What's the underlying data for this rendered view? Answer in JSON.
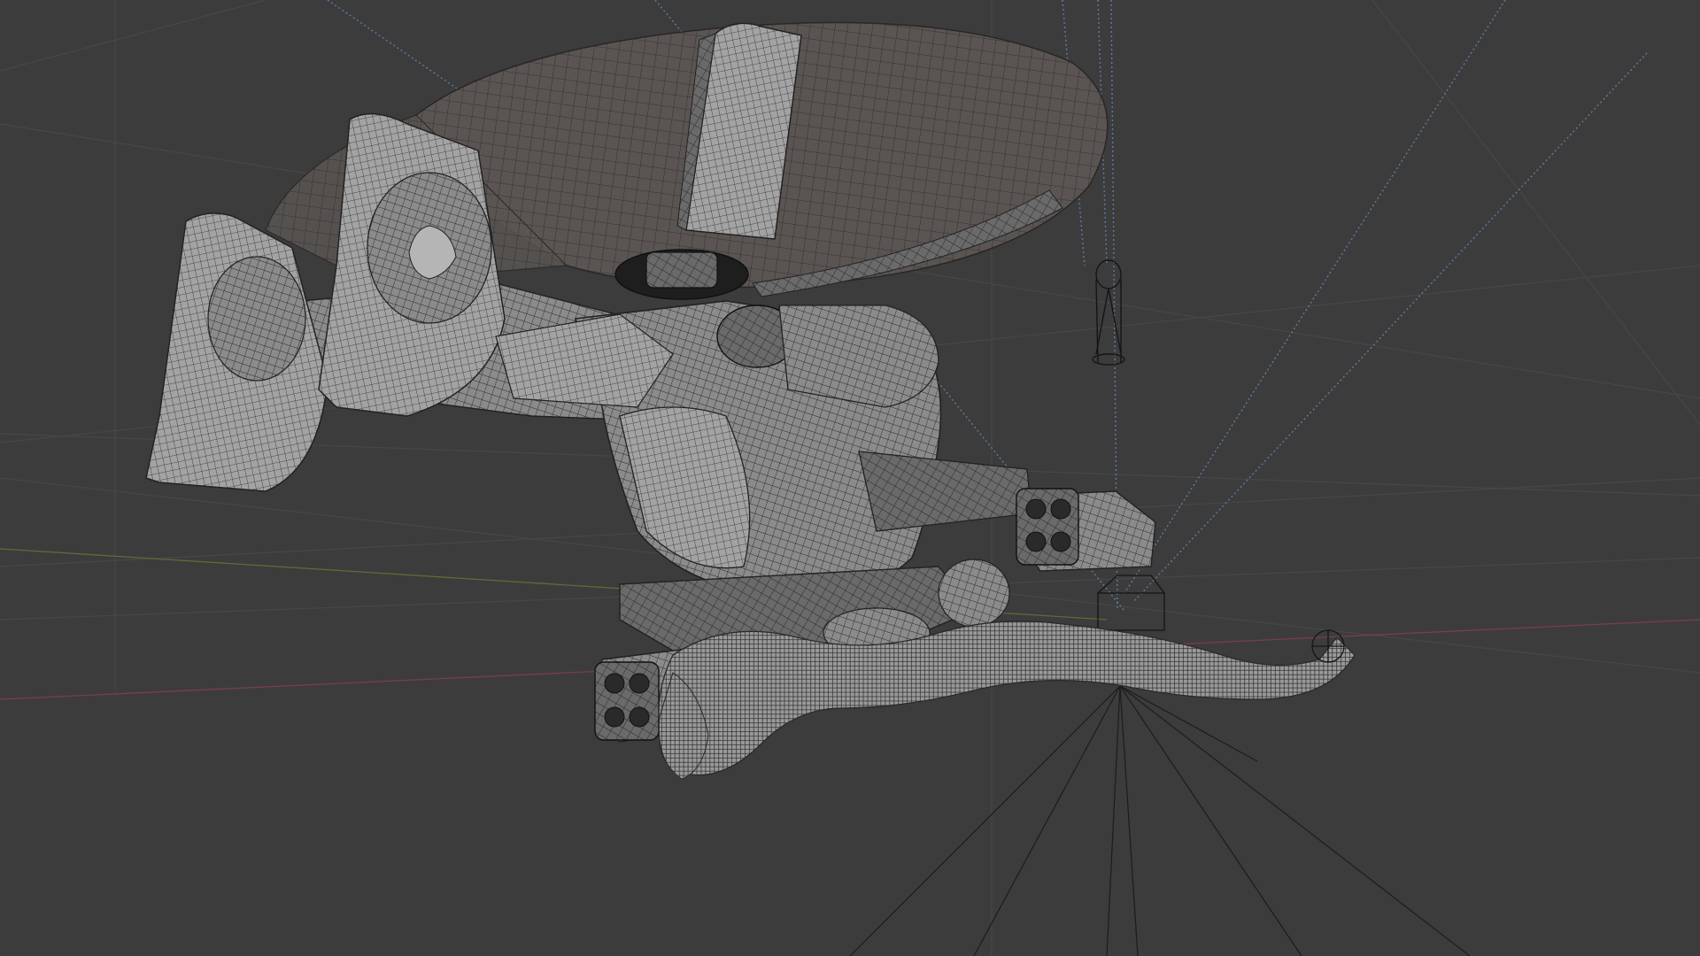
{
  "viewport": {
    "background": "#3c3c3c",
    "grid_color": "#4a4a4a",
    "axis_x_color": "#8a4a52",
    "axis_y_color": "#6e7a3a",
    "wire_color": "#1e1e1e",
    "surface_color": "#8a8a8a",
    "guide_color": "#5f7aa8",
    "object": "helicopter-wireframe-model",
    "smoke_object": "smoke-trail",
    "light_object": "light-gizmo"
  }
}
